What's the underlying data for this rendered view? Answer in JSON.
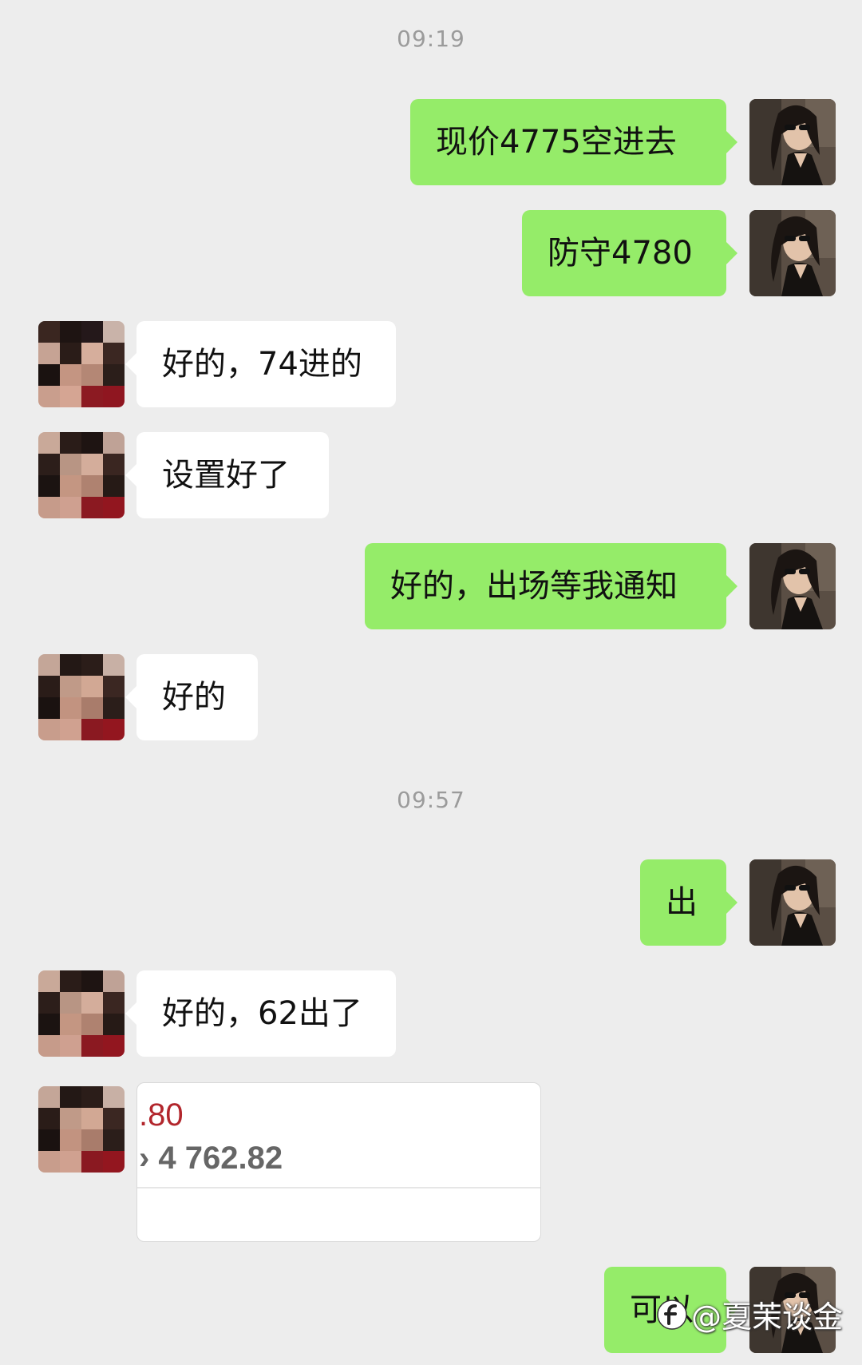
{
  "timestamps": [
    "09:19",
    "09:57"
  ],
  "messages": [
    {
      "side": "out",
      "text": "现价4775空进去"
    },
    {
      "side": "out",
      "text": "防守4780"
    },
    {
      "side": "in",
      "text": "好的，74进的"
    },
    {
      "side": "in",
      "text": "设置好了"
    },
    {
      "side": "out",
      "text": "好的，出场等我通知"
    },
    {
      "side": "in",
      "text": "好的"
    },
    {
      "side": "out",
      "text": "出"
    },
    {
      "side": "in",
      "text": "好的，62出了"
    },
    {
      "side": "out",
      "text": "可以"
    }
  ],
  "image_message": {
    "line1": ".80",
    "line2": "› 4 762.82",
    "line1_color": "#B2262C"
  },
  "watermark": {
    "text": "@夏茉谈金"
  },
  "colors": {
    "background": "#EDEDED",
    "outgoing_bubble": "#95EC69",
    "incoming_bubble": "#FFFFFF",
    "timestamp": "#9B9B9B"
  }
}
